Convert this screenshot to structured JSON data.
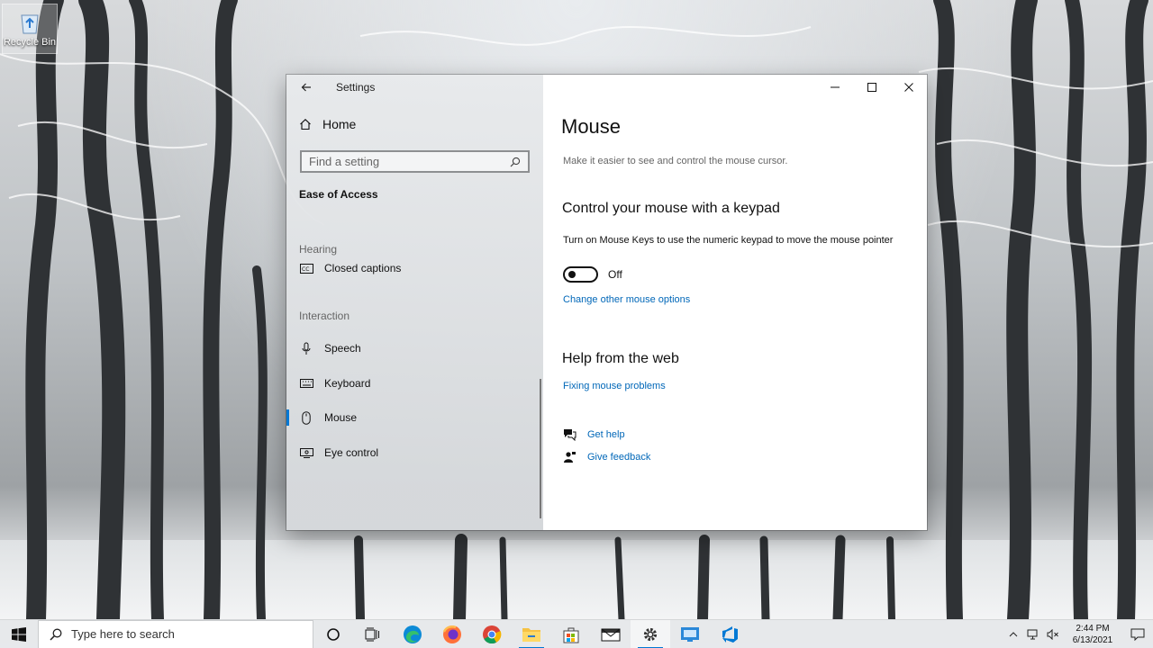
{
  "desktop": {
    "recycle_bin_label": "Recycle Bin"
  },
  "window": {
    "title": "Settings",
    "back_icon": "back-arrow-icon",
    "controls": [
      "minimize",
      "maximize",
      "close"
    ]
  },
  "nav": {
    "home_label": "Home",
    "search_placeholder": "Find a setting",
    "section_title": "Ease of Access",
    "groups": {
      "hearing": "Hearing",
      "interaction": "Interaction"
    },
    "items": [
      {
        "label": "Closed captions",
        "icon": "closed-captions-icon"
      },
      {
        "label": "Speech",
        "icon": "microphone-icon"
      },
      {
        "label": "Keyboard",
        "icon": "keyboard-icon"
      },
      {
        "label": "Mouse",
        "icon": "mouse-icon",
        "selected": true
      },
      {
        "label": "Eye control",
        "icon": "eye-control-icon"
      }
    ]
  },
  "content": {
    "title": "Mouse",
    "description": "Make it easier to see and control the mouse cursor.",
    "keypad_heading": "Control your mouse with a keypad",
    "mouse_keys_text": "Turn on Mouse Keys to use the numeric keypad to move the mouse pointer",
    "toggle_state": "Off",
    "change_options_link": "Change other mouse options",
    "help_heading": "Help from the web",
    "fixing_link": "Fixing mouse problems",
    "get_help": "Get help",
    "give_feedback": "Give feedback"
  },
  "taskbar": {
    "search_placeholder": "Type here to search",
    "apps": [
      "cortana",
      "task-view",
      "edge",
      "firefox",
      "chrome",
      "file-explorer",
      "store",
      "mail",
      "settings",
      "remote-desktop",
      "azure-devops"
    ],
    "time": "2:44 PM",
    "date": "6/13/2021"
  },
  "colors": {
    "accent": "#0078d4",
    "link": "#0067b8"
  }
}
